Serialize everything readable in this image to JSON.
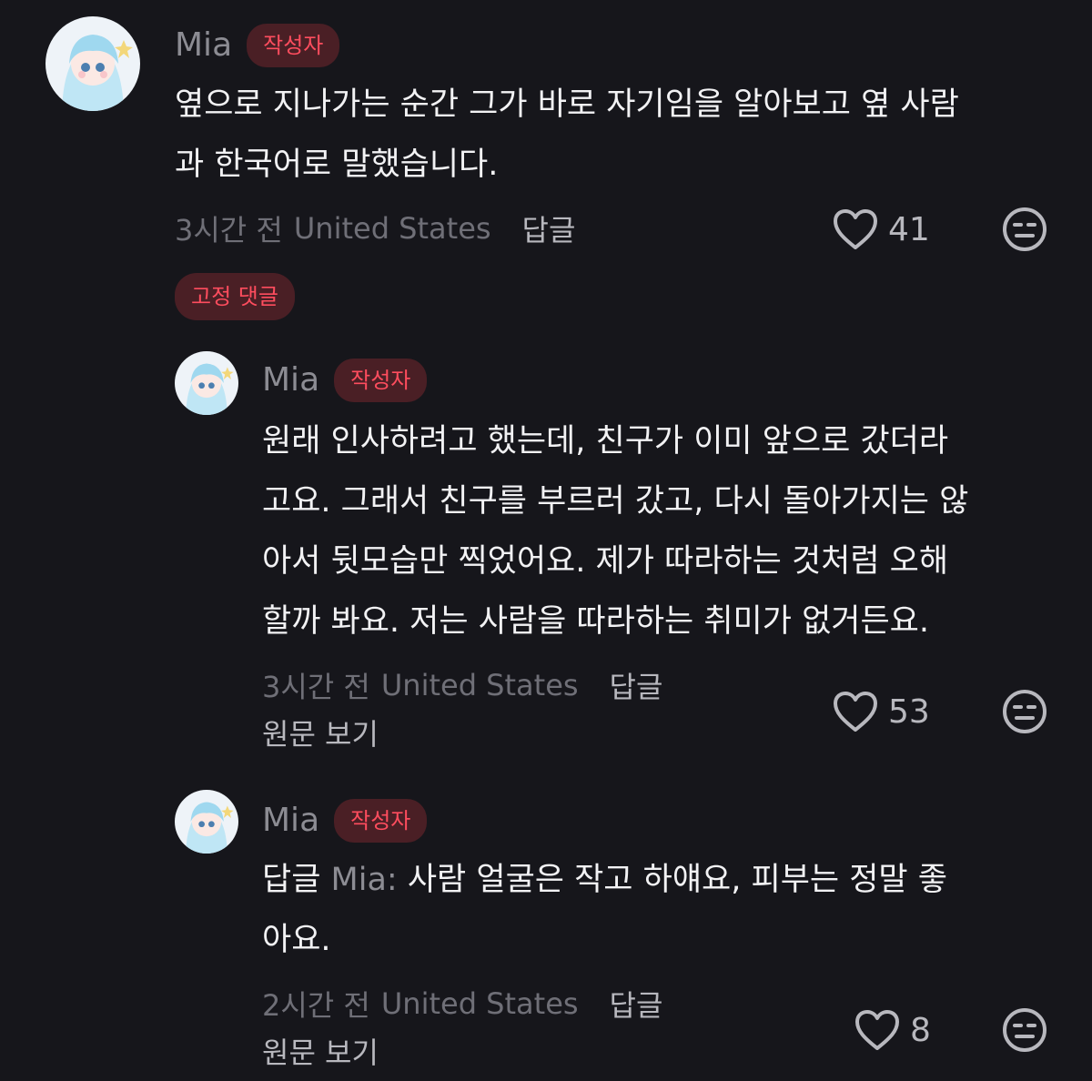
{
  "colors": {
    "background": "#16161b",
    "badge_bg": "#4a1f25",
    "badge_text": "#ff4d5e",
    "muted": "#8c8c93"
  },
  "comments": [
    {
      "author": "Mia",
      "badge": "작성자",
      "text_lines": [
        "옆으로 지나가는 순간 그가 바로 자기임을 알아보고 옆 사람",
        "과 한국어로 말했습니다."
      ],
      "time": "3시간 전",
      "location": "United States",
      "reply_label": "답글",
      "likes": "41",
      "reaction_icon": "neutral-face-icon"
    },
    {
      "author": "Mia",
      "badge": "작성자",
      "text_lines": [
        "원래 인사하려고 했는데, 친구가 이미 앞으로 갔더라",
        "고요. 그래서 친구를 부르러 갔고, 다시 돌아가지는 않",
        "아서 뒷모습만 찍었어요. 제가 따라하는 것처럼 오해",
        "할까 봐요. 저는 사람을 따라하는 취미가 없거든요."
      ],
      "time": "3시간 전",
      "location": "United States",
      "reply_label": "답글",
      "view_original": "원문 보기",
      "likes": "53",
      "reaction_icon": "neutral-face-icon"
    },
    {
      "author": "Mia",
      "badge": "작성자",
      "reply_prefix": "답글",
      "mention": "Mia:",
      "text_lines": [
        "사람 얼굴은 작고 하얘요, 피부는 정말 좋",
        "아요."
      ],
      "time": "2시간 전",
      "location": "United States",
      "reply_label": "답글",
      "view_original": "원문 보기",
      "likes": "8",
      "reaction_icon": "neutral-face-icon"
    }
  ],
  "pinned_label": "고정 댓글"
}
